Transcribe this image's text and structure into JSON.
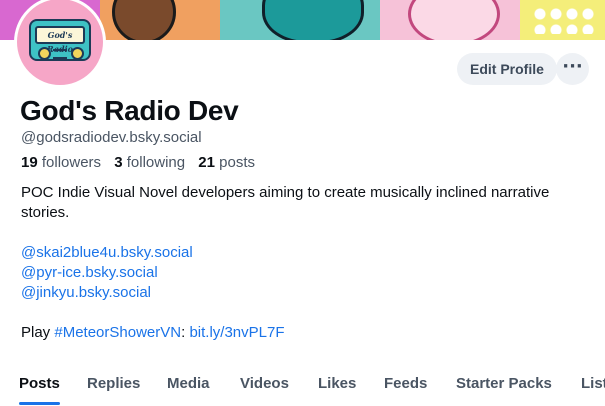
{
  "profile": {
    "display_name": "God's Radio Dev",
    "handle": "@godsradiodev.bsky.social",
    "avatar_text": "God's Radio",
    "stats": {
      "followers_count": "19",
      "followers_label": "followers",
      "following_count": "3",
      "following_label": "following",
      "posts_count": "21",
      "posts_label": "posts"
    }
  },
  "actions": {
    "edit_label": "Edit Profile",
    "more_label": "···"
  },
  "bio": {
    "line1": "POC Indie Visual Novel developers aiming to create musically inclined narrative stories.",
    "mentions": [
      "@skai2blue4u.bsky.social",
      "@pyr-ice.bsky.social",
      "@jinkyu.bsky.social"
    ],
    "play_prefix": "Play",
    "hashtag": "#MeteorShowerVN",
    "colon": ":",
    "link": "bit.ly/3nvPL7F"
  },
  "tabs": [
    "Posts",
    "Replies",
    "Media",
    "Videos",
    "Likes",
    "Feeds",
    "Starter Packs",
    "Lists"
  ],
  "active_tab": "Posts",
  "colors": {
    "accent": "#1a73e8",
    "text": "#0b0f14",
    "muted": "#4a5563",
    "button_bg": "#eef1f5"
  }
}
